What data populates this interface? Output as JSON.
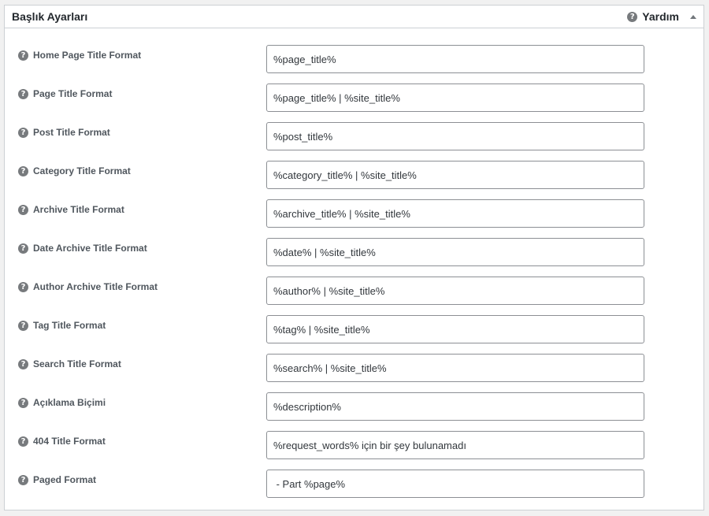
{
  "panel": {
    "title": "Başlık Ayarları",
    "help_label": "Yardım"
  },
  "icons": {
    "help": "question-circle-icon",
    "collapse": "triangle-up-icon"
  },
  "fields": [
    {
      "label": "Home Page Title Format",
      "value": "%page_title%"
    },
    {
      "label": "Page Title Format",
      "value": "%page_title% | %site_title%"
    },
    {
      "label": "Post Title Format",
      "value": "%post_title%"
    },
    {
      "label": "Category Title Format",
      "value": "%category_title% | %site_title%"
    },
    {
      "label": "Archive Title Format",
      "value": "%archive_title% | %site_title%"
    },
    {
      "label": "Date Archive Title Format",
      "value": "%date% | %site_title%"
    },
    {
      "label": "Author Archive Title Format",
      "value": "%author% | %site_title%"
    },
    {
      "label": "Tag Title Format",
      "value": "%tag% | %site_title%"
    },
    {
      "label": "Search Title Format",
      "value": "%search% | %site_title%"
    },
    {
      "label": "Açıklama Biçimi",
      "value": "%description%"
    },
    {
      "label": "404 Title Format",
      "value": "%request_words% için bir şey bulunamadı"
    },
    {
      "label": "Paged Format",
      "value": " - Part %page%"
    }
  ]
}
